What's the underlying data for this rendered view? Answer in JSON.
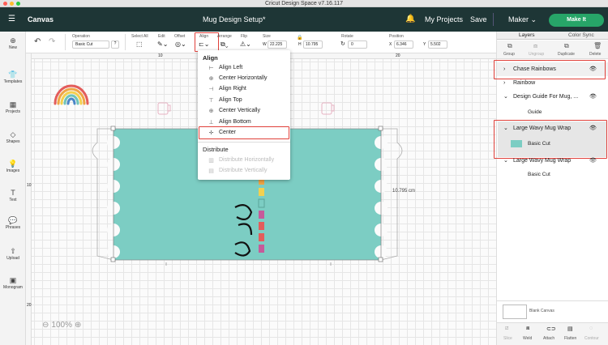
{
  "window": {
    "title": "Cricut Design Space  v7.16.117"
  },
  "header": {
    "canvas_label": "Canvas",
    "project_title": "Mug Design Setup*",
    "my_projects": "My Projects",
    "save": "Save",
    "machine": "Maker",
    "make_it": "Make It"
  },
  "toolbar": {
    "operation_label": "Operation",
    "operation_value": "Basic Cut",
    "select_all": "Select All",
    "edit": "Edit",
    "offset": "Offset",
    "align": "Align",
    "arrange": "Arrange",
    "flip": "Flip",
    "size": "Size",
    "w_label": "W",
    "w_value": "22.225",
    "h_label": "H",
    "h_value": "10.795",
    "rotate": "Rotate",
    "rotate_value": "0",
    "position": "Position",
    "x_label": "X",
    "x_value": "6.346",
    "y_label": "Y",
    "y_value": "5.502"
  },
  "left_nav": {
    "items": [
      {
        "label": "New",
        "icon": "plus-icon"
      },
      {
        "label": "Templates",
        "icon": "shirt-icon"
      },
      {
        "label": "Projects",
        "icon": "projects-icon"
      },
      {
        "label": "Shapes",
        "icon": "shapes-icon"
      },
      {
        "label": "Images",
        "icon": "image-icon"
      },
      {
        "label": "Text",
        "icon": "text-icon"
      },
      {
        "label": "Phrases",
        "icon": "phrases-icon"
      },
      {
        "label": "Upload",
        "icon": "upload-icon"
      },
      {
        "label": "Monogram",
        "icon": "monogram-icon"
      }
    ]
  },
  "canvas": {
    "ruler_top": [
      "10",
      "20"
    ],
    "ruler_left": [
      "10",
      "20"
    ],
    "dimension_label": "10.795 cm",
    "zoom": "100%"
  },
  "align_menu": {
    "header": "Align",
    "items": [
      "Align Left",
      "Center Horizontally",
      "Align Right",
      "Align Top",
      "Center Vertically",
      "Align Bottom",
      "Center"
    ],
    "distribute_header": "Distribute",
    "distribute_items": [
      "Distribute Horizontally",
      "Distribute Vertically"
    ]
  },
  "layers": {
    "tabs": [
      "Layers",
      "Color Sync"
    ],
    "actions": [
      "Group",
      "Ungroup",
      "Duplicate",
      "Delete"
    ],
    "items": [
      {
        "name": "Chase Rainbows",
        "expanded": false
      },
      {
        "name": "Rainbow",
        "expanded": false
      },
      {
        "name": "Design Guide For Mug, ...",
        "expanded": true,
        "sub": "Guide"
      },
      {
        "name": "Large Wavy Mug Wrap",
        "expanded": true,
        "sub": "Basic Cut"
      },
      {
        "name": "Large Wavy Mug Wrap",
        "expanded": true,
        "sub": "Basic Cut"
      }
    ],
    "blank_canvas": "Blank Canvas",
    "bottom_actions": [
      "Slice",
      "Weld",
      "Attach",
      "Flatten",
      "Contour"
    ]
  },
  "colors": {
    "header": "#1e3636",
    "accent": "#27a568",
    "wrap": "#7ccdc3",
    "highlight": "#e0403a"
  }
}
